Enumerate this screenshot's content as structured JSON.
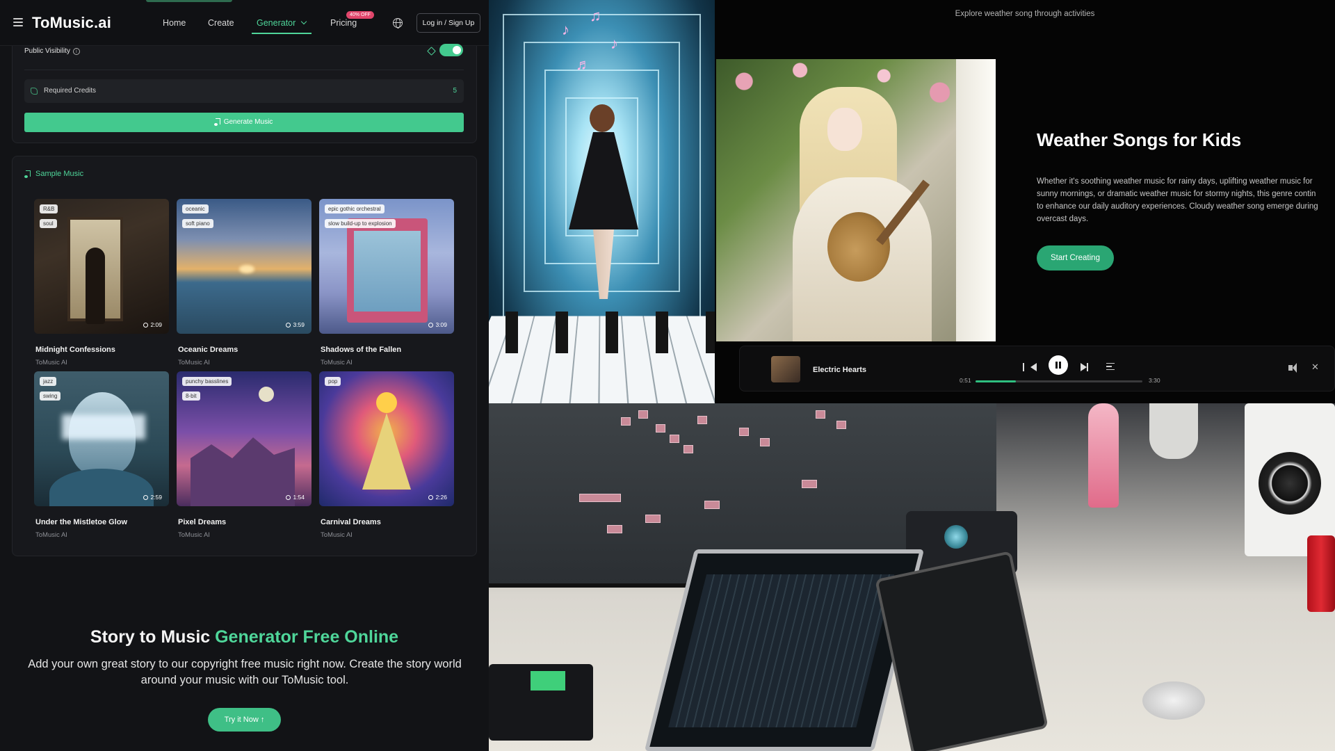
{
  "header": {
    "logo": "ToMusic.ai",
    "nav": [
      "Home",
      "Create",
      "Generator",
      "Pricing"
    ],
    "promo_badge": "40% OFF",
    "login_label": "Log in / Sign Up"
  },
  "form": {
    "public_visibility_label": "Public Visibility",
    "visibility_on": true,
    "required_credits_label": "Required Credits",
    "required_credits_value": "5",
    "generate_label": "Generate Music"
  },
  "sample": {
    "heading": "Sample Music",
    "tracks": [
      {
        "title": "Midnight Confessions",
        "artist": "ToMusic AI",
        "duration": "2:09",
        "tags": [
          "R&B",
          "soul"
        ]
      },
      {
        "title": "Oceanic Dreams",
        "artist": "ToMusic AI",
        "duration": "3:59",
        "tags": [
          "oceanic",
          "soft piano"
        ]
      },
      {
        "title": "Shadows of the Fallen",
        "artist": "ToMusic AI",
        "duration": "3:09",
        "tags": [
          "epic gothic orchestral",
          "slow build-up to explosion"
        ]
      },
      {
        "title": "Under the Mistletoe Glow",
        "artist": "ToMusic AI",
        "duration": "2:59",
        "tags": [
          "jazz",
          "swing"
        ]
      },
      {
        "title": "Pixel Dreams",
        "artist": "ToMusic AI",
        "duration": "1:54",
        "tags": [
          "punchy basslines",
          "8-bit"
        ]
      },
      {
        "title": "Carnival Dreams",
        "artist": "ToMusic AI",
        "duration": "2:26",
        "tags": [
          "pop"
        ]
      }
    ]
  },
  "cta": {
    "title_a": "Story to Music ",
    "title_b": "Generator Free Online",
    "description": "Add your own great story to our copyright free music right now. Create the story world around your music with our ToMusic tool.",
    "button": "Try it Now"
  },
  "weather": {
    "explore": "Explore weather song through activities",
    "title": "Weather Songs for Kids",
    "desc_lines": [
      "Whether it's soothing weather music for rainy days, uplifting weather music for",
      "sunny mornings, or dramatic weather music for stormy nights, this genre contin",
      "to enhance our daily auditory experiences. Cloudy weather song emerge during",
      "overcast days."
    ],
    "button": "Start Creating"
  },
  "player": {
    "song": "Electric Hearts",
    "elapsed": "0:51",
    "total": "3:30",
    "progress_fraction": 0.24
  },
  "colors": {
    "accent": "#4fd69a",
    "button_green": "#43c98e",
    "background": "#121316"
  }
}
